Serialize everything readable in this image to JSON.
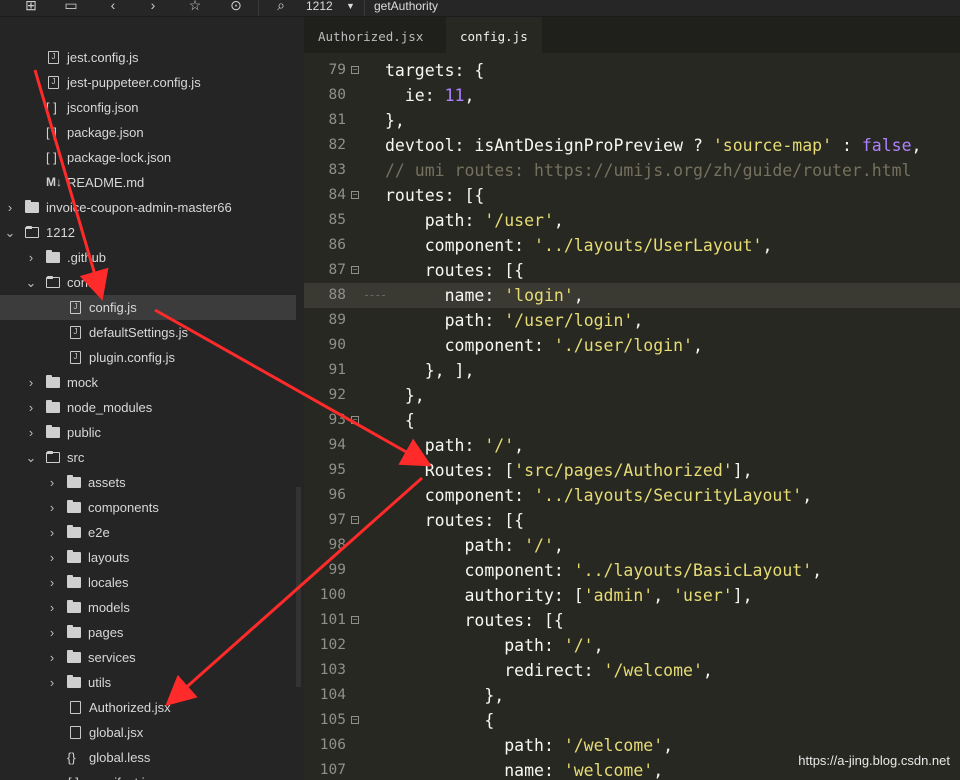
{
  "toolbar": {
    "branch": "1212",
    "function": "getAuthority",
    "icons": [
      "new-file-icon",
      "save-icon",
      "back-icon",
      "forward-icon",
      "bookmark-icon",
      "run-icon",
      "search-symbol-icon",
      "dropdown-icon"
    ]
  },
  "sidebar": {
    "items": [
      {
        "label": "jest.config.js",
        "kind": "file-js"
      },
      {
        "label": "jest-puppeteer.config.js",
        "kind": "file-js"
      },
      {
        "label": "jsconfig.json",
        "kind": "file-json"
      },
      {
        "label": "package.json",
        "kind": "file-json"
      },
      {
        "label": "package-lock.json",
        "kind": "file-json"
      },
      {
        "label": "README.md",
        "kind": "file-md"
      },
      {
        "label": "invoice-coupon-admin-master66",
        "kind": "folder-closed"
      },
      {
        "label": "1212",
        "kind": "folder-open"
      },
      {
        "label": ".github",
        "kind": "folder-closed"
      },
      {
        "label": "config",
        "kind": "folder-open"
      },
      {
        "label": "config.js",
        "kind": "file-js",
        "selected": true
      },
      {
        "label": "defaultSettings.js",
        "kind": "file-js"
      },
      {
        "label": "plugin.config.js",
        "kind": "file-js"
      },
      {
        "label": "mock",
        "kind": "folder-closed"
      },
      {
        "label": "node_modules",
        "kind": "folder-closed"
      },
      {
        "label": "public",
        "kind": "folder-closed"
      },
      {
        "label": "src",
        "kind": "folder-open"
      },
      {
        "label": "assets",
        "kind": "folder-closed"
      },
      {
        "label": "components",
        "kind": "folder-closed"
      },
      {
        "label": "e2e",
        "kind": "folder-closed"
      },
      {
        "label": "layouts",
        "kind": "folder-closed"
      },
      {
        "label": "locales",
        "kind": "folder-closed"
      },
      {
        "label": "models",
        "kind": "folder-closed"
      },
      {
        "label": "pages",
        "kind": "folder-closed"
      },
      {
        "label": "services",
        "kind": "folder-closed"
      },
      {
        "label": "utils",
        "kind": "folder-closed"
      },
      {
        "label": "Authorized.jsx",
        "kind": "file-plain"
      },
      {
        "label": "global.jsx",
        "kind": "file-plain"
      },
      {
        "label": "global.less",
        "kind": "file-less"
      },
      {
        "label": "manifest.json",
        "kind": "file-json"
      }
    ]
  },
  "tabs": [
    {
      "label": "Authorized.jsx",
      "active": false
    },
    {
      "label": "config.js",
      "active": true
    }
  ],
  "code": [
    {
      "n": "79",
      "fold": true,
      "text": "targets: {"
    },
    {
      "n": "80",
      "text": "  ie: 11,"
    },
    {
      "n": "81",
      "text": "},"
    },
    {
      "n": "82",
      "text": "devtool: isAntDesignProPreview ? 'source-map' : false,"
    },
    {
      "n": "83",
      "text": "// umi routes: https://umijs.org/zh/guide/router.html"
    },
    {
      "n": "84",
      "fold": true,
      "text": "routes: [{"
    },
    {
      "n": "85",
      "text": "    path: '/user',"
    },
    {
      "n": "86",
      "text": "    component: '../layouts/UserLayout',"
    },
    {
      "n": "87",
      "fold": true,
      "text": "    routes: [{"
    },
    {
      "n": "88",
      "highlight": true,
      "text": "      name: 'login',"
    },
    {
      "n": "89",
      "text": "      path: '/user/login',"
    },
    {
      "n": "90",
      "text": "      component: './user/login',"
    },
    {
      "n": "91",
      "text": "    }, ],"
    },
    {
      "n": "92",
      "text": "  },"
    },
    {
      "n": "93",
      "fold": true,
      "text": "  {"
    },
    {
      "n": "94",
      "text": "    path: '/',"
    },
    {
      "n": "95",
      "text": "    Routes: ['src/pages/Authorized'],"
    },
    {
      "n": "96",
      "text": "    component: '../layouts/SecurityLayout',"
    },
    {
      "n": "97",
      "fold": true,
      "text": "    routes: [{"
    },
    {
      "n": "98",
      "text": "        path: '/',"
    },
    {
      "n": "99",
      "text": "        component: '../layouts/BasicLayout',"
    },
    {
      "n": "100",
      "text": "        authority: ['admin', 'user'],"
    },
    {
      "n": "101",
      "fold": true,
      "text": "        routes: [{"
    },
    {
      "n": "102",
      "text": "            path: '/',"
    },
    {
      "n": "103",
      "text": "            redirect: '/welcome',"
    },
    {
      "n": "104",
      "text": "          },"
    },
    {
      "n": "105",
      "fold": true,
      "text": "          {"
    },
    {
      "n": "106",
      "text": "            path: '/welcome',"
    },
    {
      "n": "107",
      "text": "            name: 'welcome',"
    }
  ],
  "watermark": "https://a-jing.blog.csdn.net",
  "colors": {
    "arrow": "#ff2a2a",
    "string": "#e6db74",
    "number": "#ae81ff",
    "comment": "#75715e"
  }
}
